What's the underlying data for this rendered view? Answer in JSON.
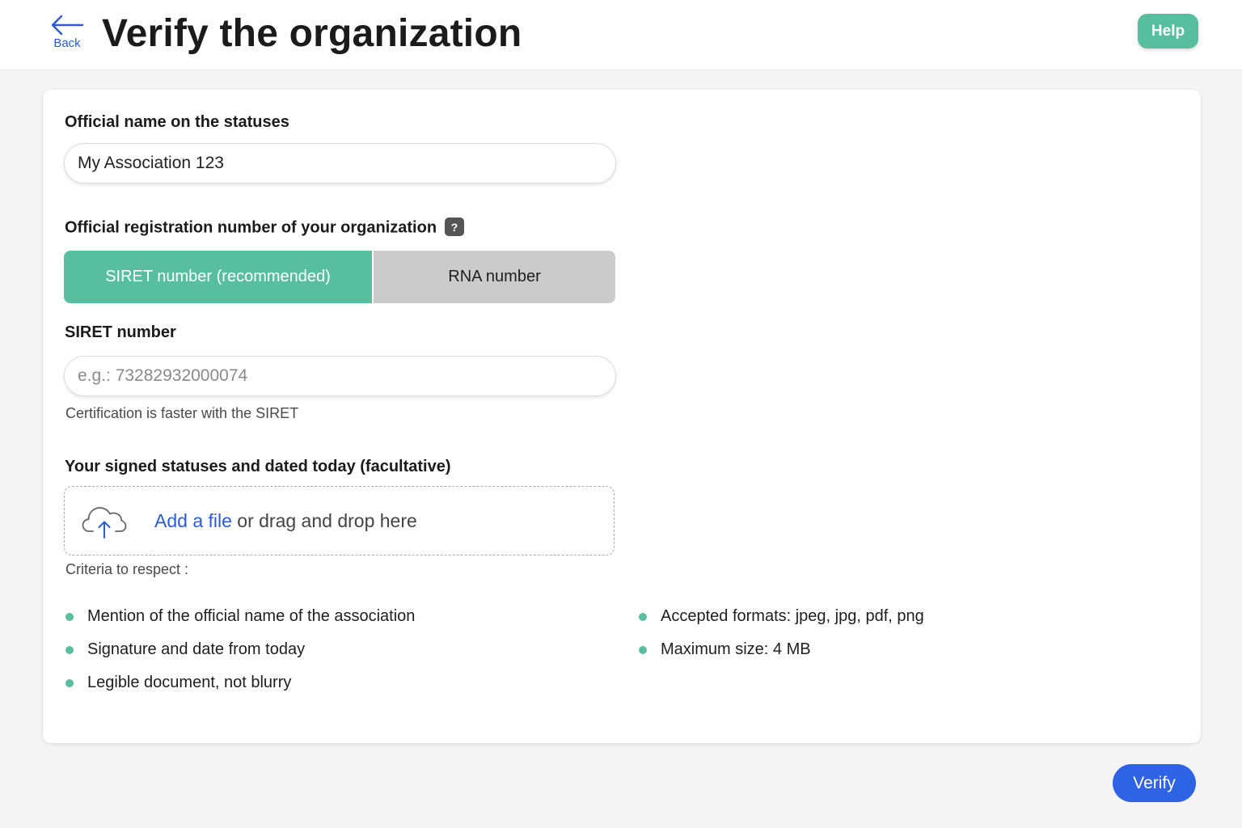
{
  "header": {
    "back_label": "Back",
    "title": "Verify the organization",
    "help_label": "Help"
  },
  "form": {
    "official_name": {
      "label": "Official name on the statuses",
      "value": "My Association 123"
    },
    "registration": {
      "label": "Official registration number of your organization",
      "help_icon_glyph": "?",
      "options": [
        {
          "label": "SIRET number (recommended)",
          "selected": true
        },
        {
          "label": "RNA number",
          "selected": false
        }
      ]
    },
    "siret": {
      "label": "SIRET number",
      "placeholder": "e.g.: 73282932000074",
      "value": "",
      "helper": "Certification is faster with the SIRET"
    },
    "upload": {
      "label": "Your signed statuses and dated today (facultative)",
      "link_text": "Add a file",
      "rest_text": " or drag and drop here",
      "icon": "cloud-upload-icon"
    },
    "criteria": {
      "title": "Criteria to respect :",
      "left": [
        "Mention of the official name of the association",
        "Signature and date from today",
        "Legible document, not blurry"
      ],
      "right": [
        "Accepted formats: jpeg, jpg, pdf, png",
        "Maximum size: 4 MB"
      ]
    }
  },
  "footer": {
    "verify_label": "Verify"
  },
  "colors": {
    "accent_green": "#57bf9d",
    "primary_blue": "#2e63e6",
    "link_blue": "#2b5cd8"
  }
}
